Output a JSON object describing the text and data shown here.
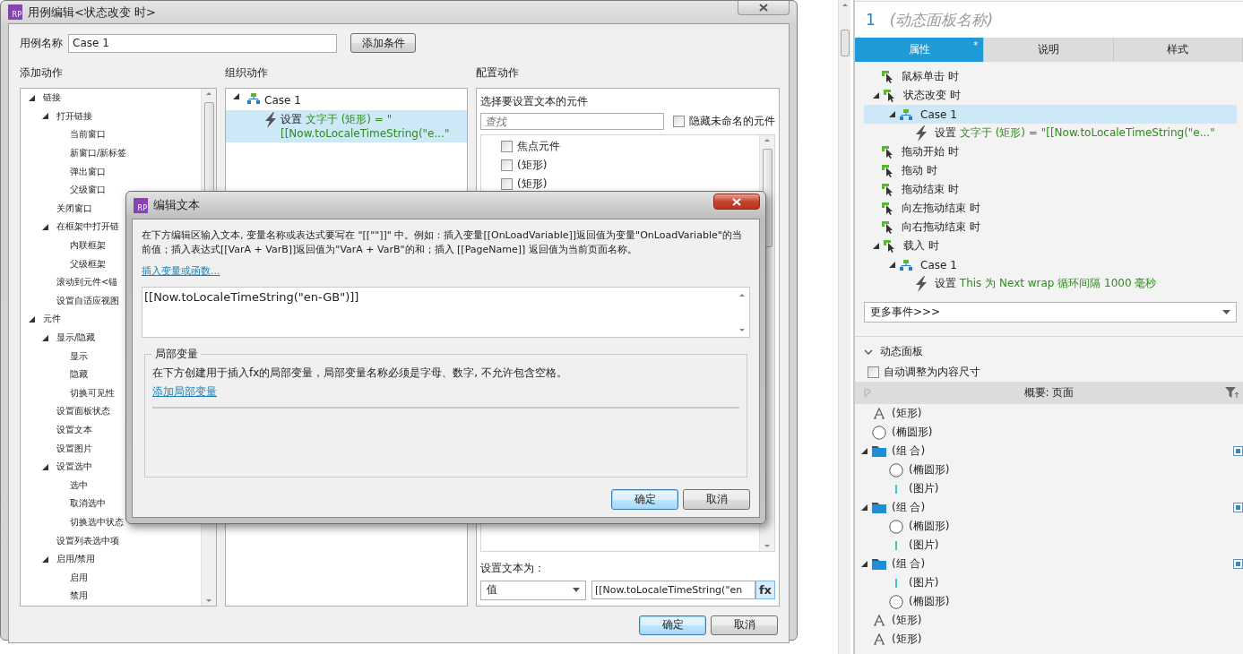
{
  "case_editor": {
    "icon_text": "RP",
    "title": "用例编辑<状态改变 时>",
    "case_name": {
      "label": "用例名称",
      "value": "Case 1"
    },
    "add_condition_button": "添加条件",
    "add_actions": {
      "heading": "添加动作",
      "tree": [
        {
          "label": "链接",
          "expanded": true,
          "children": [
            {
              "label": "打开链接",
              "expanded": true,
              "children": [
                {
                  "label": "当前窗口"
                },
                {
                  "label": "新窗口/新标签"
                },
                {
                  "label": "弹出窗口"
                },
                {
                  "label": "父级窗口"
                }
              ]
            },
            {
              "label": "关闭窗口"
            },
            {
              "label": "在框架中打开链",
              "expanded": true,
              "children": [
                {
                  "label": "内联框架"
                },
                {
                  "label": "父级框架"
                }
              ]
            },
            {
              "label": "滚动到元件<锚"
            },
            {
              "label": "设置自适应视图"
            }
          ]
        },
        {
          "label": "元件",
          "expanded": true,
          "children": [
            {
              "label": "显示/隐藏",
              "expanded": true,
              "children": [
                {
                  "label": "显示"
                },
                {
                  "label": "隐藏"
                },
                {
                  "label": "切换可见性"
                }
              ]
            },
            {
              "label": "设置面板状态"
            },
            {
              "label": "设置文本"
            },
            {
              "label": "设置图片"
            },
            {
              "label": "设置选中",
              "expanded": true,
              "children": [
                {
                  "label": "选中"
                },
                {
                  "label": "取消选中"
                },
                {
                  "label": "切换选中状态"
                }
              ]
            },
            {
              "label": "设置列表选中项"
            },
            {
              "label": "启用/禁用",
              "expanded": true,
              "children": [
                {
                  "label": "启用"
                },
                {
                  "label": "禁用"
                }
              ]
            }
          ]
        }
      ]
    },
    "organize_actions": {
      "heading": "组织动作",
      "tree": [
        {
          "kind": "case",
          "label": "Case 1",
          "expanded": true,
          "selected": false,
          "children": [
            {
              "kind": "action",
              "verb": "设置",
              "detail": "文字于 (矩形) = \"[[Now.toLocaleTimeString(\"e...\"",
              "selected": true
            }
          ]
        }
      ]
    },
    "configure": {
      "heading": "配置动作",
      "target_label": "选择要设置文本的元件",
      "search": {
        "placeholder": "查找"
      },
      "hide_unnamed": {
        "label": "隐藏未命名的元件",
        "checked": false
      },
      "widgets": [
        {
          "label": "焦点元件",
          "checked": false
        },
        {
          "label": "(矩形)",
          "checked": false
        },
        {
          "label": "(矩形)",
          "checked": false
        }
      ],
      "set_text_label": "设置文本为：",
      "value_type": "值",
      "value": "[[Now.toLocaleTimeString(\"en",
      "fx_button": "fx"
    },
    "buttons": [
      {
        "label": "确定",
        "default": true
      },
      {
        "label": "取消",
        "default": false
      }
    ]
  },
  "edit_text_dialog": {
    "icon_text": "RP",
    "title": "编辑文本",
    "description": "在下方编辑区输入文本, 变量名称或表达式要写在 \"[[\"\"]]\" 中。例如：插入变量[[OnLoadVariable]]返回值为变量\"OnLoadVariable\"的当前值；插入表达式[[VarA + VarB]]返回值为\"VarA + VarB\"的和；插入 [[PageName]] 返回值为当前页面名称。",
    "insert_link": "插入变量或函数...",
    "text": "[[Now.toLocaleTimeString(\"en-GB\")]]",
    "local_vars": {
      "legend": "局部变量",
      "hint": "在下方创建用于插入fx的局部变量，局部变量名称必须是字母、数字, 不允许包含空格。",
      "add_link": "添加局部变量"
    },
    "buttons": [
      {
        "label": "确定",
        "default": true
      },
      {
        "label": "取消",
        "default": false
      }
    ]
  },
  "inspector": {
    "index": "1",
    "name_placeholder": "(动态面板名称)",
    "tabs": [
      {
        "label": "属性",
        "selected": true,
        "badge": "*"
      },
      {
        "label": "说明",
        "selected": false
      },
      {
        "label": "样式",
        "selected": false
      }
    ],
    "events": [
      {
        "kind": "event",
        "label": "鼠标单击 时",
        "selected": false
      },
      {
        "kind": "event",
        "label": "状态改变 时",
        "expanded": true,
        "selected": false,
        "children": [
          {
            "kind": "case",
            "label": "Case 1",
            "expanded": true,
            "selected": true,
            "children": [
              {
                "kind": "action",
                "verb": "设置",
                "detail": "文字于 (矩形) = \"[[Now.toLocaleTimeString(\"e...\"",
                "selected": false
              }
            ]
          }
        ]
      },
      {
        "kind": "event",
        "label": "拖动开始 时",
        "selected": false
      },
      {
        "kind": "event",
        "label": "拖动 时",
        "selected": false
      },
      {
        "kind": "event",
        "label": "拖动结束 时",
        "selected": false
      },
      {
        "kind": "event",
        "label": "向左拖动结束 时",
        "selected": false
      },
      {
        "kind": "event",
        "label": "向右拖动结束 时",
        "selected": false
      },
      {
        "kind": "event",
        "label": "载入 时",
        "expanded": true,
        "selected": false,
        "children": [
          {
            "kind": "case",
            "label": "Case 1",
            "expanded": true,
            "selected": false,
            "children": [
              {
                "kind": "action",
                "verb": "设置",
                "detail": "This 为 Next wrap 循环间隔 1000 毫秒",
                "selected": false
              }
            ]
          }
        ]
      }
    ],
    "more_events": "更多事件>>>",
    "section": {
      "title": "动态面板",
      "expanded": true
    },
    "fit_content": {
      "label": "自动调整为内容尺寸",
      "checked": false
    },
    "outline": {
      "title": "概要: 页面",
      "items": [
        {
          "kind": "text",
          "label": "(矩形)",
          "marked": false
        },
        {
          "kind": "ellipse",
          "label": "(椭圆形)",
          "marked": false
        },
        {
          "kind": "group",
          "label": "(组 合)",
          "expanded": true,
          "marked": true,
          "children": [
            {
              "kind": "ellipse",
              "label": "(椭圆形)",
              "marked": false
            },
            {
              "kind": "image",
              "label": "(图片)",
              "marked": false
            }
          ]
        },
        {
          "kind": "group",
          "label": "(组 合)",
          "expanded": true,
          "marked": true,
          "children": [
            {
              "kind": "ellipse",
              "label": "(椭圆形)",
              "marked": false
            },
            {
              "kind": "image",
              "label": "(图片)",
              "marked": false
            }
          ]
        },
        {
          "kind": "group",
          "label": "(组 合)",
          "expanded": true,
          "marked": true,
          "children": [
            {
              "kind": "image",
              "label": "(图片)",
              "marked": false
            },
            {
              "kind": "ellipse",
              "label": "(椭圆形)",
              "marked": false
            }
          ]
        },
        {
          "kind": "text",
          "label": "(矩形)",
          "marked": false
        },
        {
          "kind": "text",
          "label": "(矩形)",
          "marked": false
        }
      ]
    }
  }
}
